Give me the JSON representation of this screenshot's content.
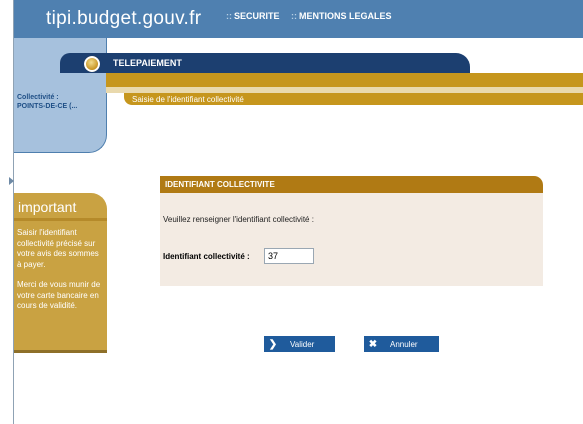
{
  "header": {
    "site_title": "tipi.budget.gouv.fr",
    "links": [
      {
        "label": "SECURITE"
      },
      {
        "label": "MENTIONS LEGALES"
      }
    ],
    "link_dots": "::"
  },
  "tab": {
    "title": "TELEPAIEMENT"
  },
  "sidebar": {
    "collectivite_label": "Collectivité :",
    "collectivite_value": "POINTS-DE-CE (..."
  },
  "breadcrumb": {
    "step": "Saisie de l'identifiant collectivité"
  },
  "important": {
    "title": "important",
    "paragraph1": "Saisir l'identifiant collectivité précisé sur votre avis des sommes à payer.",
    "paragraph2": "Merci de vous munir de votre carte bancaire en cours de validité."
  },
  "form": {
    "title": "IDENTIFIANT COLLECTIVITE",
    "intro": "Veuillez renseigner l'identifiant collectivité :",
    "field_label": "Identifiant collectivité :",
    "field_value": "37"
  },
  "buttons": {
    "valider": {
      "label": "Valider",
      "icon": "arrow-right-icon",
      "glyph": "❯"
    },
    "annuler": {
      "label": "Annuler",
      "icon": "cross-icon",
      "glyph": "✖"
    }
  },
  "colors": {
    "header_blue": "#4f80b0",
    "navy": "#1c3f70",
    "gold": "#c6961d",
    "form_header": "#b07a14",
    "button_blue": "#1f5b9c"
  }
}
